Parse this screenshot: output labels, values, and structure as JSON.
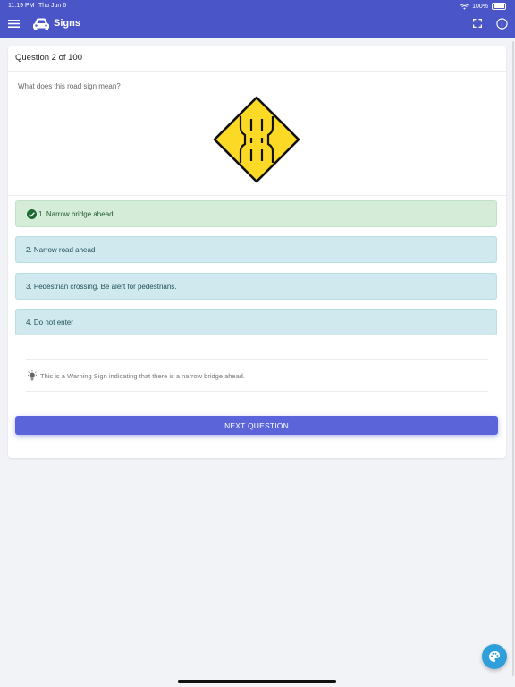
{
  "status_bar": {
    "time": "11:19 PM",
    "date": "Thu Jun 6",
    "battery": "100%"
  },
  "app_bar": {
    "title": "Signs",
    "color": "#4a55c8"
  },
  "question": {
    "header": "Question 2 of 100",
    "prompt": "What does this road sign mean?",
    "sign_icon": "narrow-bridge-warning-sign"
  },
  "options": [
    {
      "label": "1. Narrow bridge ahead",
      "correct": true
    },
    {
      "label": "2. Narrow road ahead",
      "correct": false
    },
    {
      "label": "3. Pedestrian crossing. Be alert for pedestrians.",
      "correct": false
    },
    {
      "label": "4. Do not enter",
      "correct": false
    }
  ],
  "explanation": "This is a Warning Sign indicating that there is a narrow bridge ahead.",
  "next_button": "NEXT QUESTION",
  "colors": {
    "correct_bg": "#d5ecd9",
    "option_bg": "#cfe9ee",
    "button": "#5b64d8",
    "fab": "#2f9fdc"
  }
}
